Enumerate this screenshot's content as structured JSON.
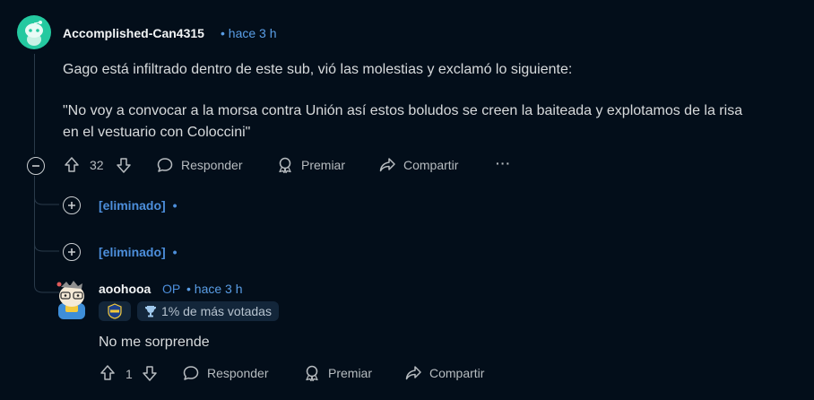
{
  "comment": {
    "author": "Accomplished-Can4315",
    "time": "• hace 3 h",
    "body_lines": [
      "Gago está infiltrado dentro de este sub, vió las molestias y exclamó lo siguiente:",
      "\"No voy a convocar a la morsa contra Unión así estos boludos se creen la baiteada y explotamos de la risa",
      "en el vestuario con Coloccini\""
    ],
    "votes": "32",
    "actions": {
      "reply": "Responder",
      "award": "Premiar",
      "share": "Compartir",
      "more": "···"
    }
  },
  "deleted_replies": [
    {
      "label": "[eliminado]",
      "dot": "•"
    },
    {
      "label": "[eliminado]",
      "dot": "•"
    }
  ],
  "reply": {
    "author": "aoohooa",
    "op": "OP",
    "time": "• hace 3 h",
    "flair": "1% de más votadas",
    "body": "No me sorprende",
    "votes": "1",
    "actions": {
      "reply": "Responder",
      "award": "Premiar",
      "share": "Compartir"
    }
  },
  "colors": {
    "background": "#030e1a",
    "accent": "#4d8fdc",
    "avatar_bg": "#24c9a0"
  },
  "icons": [
    "collapse-icon",
    "upvote-icon",
    "downvote-icon",
    "comment-icon",
    "award-icon",
    "share-icon",
    "more-icon",
    "expand-icon",
    "team-badge-icon",
    "trophy-icon"
  ]
}
